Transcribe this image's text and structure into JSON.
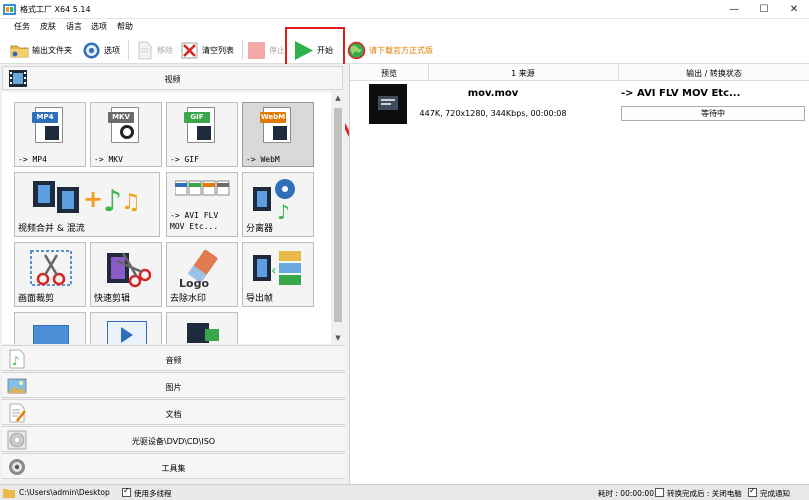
{
  "window": {
    "title": "格式工厂 X64 5.14",
    "minimize": "—",
    "maximize": "☐",
    "close": "✕"
  },
  "menu": [
    "任务",
    "皮肤",
    "语言",
    "选项",
    "帮助"
  ],
  "toolbar": {
    "output_folder": "输出文件夹",
    "options": "选项",
    "remove": "移除",
    "clear_list": "清空列表",
    "stop": "停止",
    "start": "开始",
    "download_official": "请下载官方正式版"
  },
  "left_panel": {
    "video_category": "视频",
    "tiles": [
      {
        "label": "-> MP4",
        "tag": "MP4"
      },
      {
        "label": "-> MKV",
        "tag": "MKV"
      },
      {
        "label": "-> GIF",
        "tag": "GIF"
      },
      {
        "label": "-> WebM",
        "tag": "WebM"
      },
      {
        "label": "视频合并 & 混流"
      },
      {
        "label": "-> AVI FLV",
        "label2": "MOV Etc..."
      },
      {
        "label": "分离器"
      },
      {
        "label": "画面裁剪"
      },
      {
        "label": "快速剪辑"
      },
      {
        "label": "去除水印",
        "logo_text": "Logo"
      },
      {
        "label": "导出帧"
      }
    ],
    "categories": [
      "音频",
      "图片",
      "文档",
      "光驱设备\\DVD\\CD\\ISO",
      "工具集"
    ]
  },
  "task_list": {
    "columns": [
      "预览",
      "1 来源",
      "输出 / 转换状态"
    ],
    "rows": [
      {
        "file_name": "mov.mov",
        "info": "447K, 720x1280, 344Kbps, 00:00:08",
        "output": "-> AVI FLV MOV Etc...",
        "status": "等待中"
      }
    ]
  },
  "status_bar": {
    "path": "C:\\Users\\admin\\Desktop",
    "multithread": "使用多线程",
    "elapsed": "耗时 : 00:00:00",
    "after_done": "转换完成后 : 关闭电脑",
    "notify": "完成通知"
  },
  "colors": {
    "highlight": "#e11d1d",
    "start_green": "#2db34a",
    "download_orange": "#e07a00"
  }
}
